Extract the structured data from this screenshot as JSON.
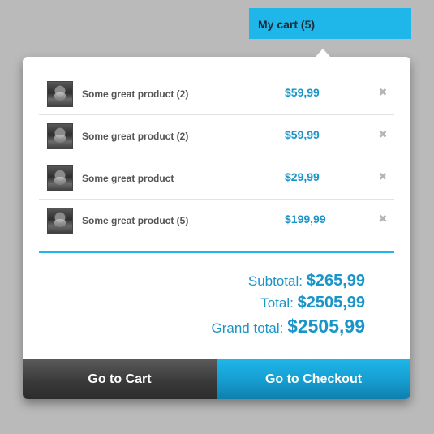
{
  "cart_tab": {
    "label": "My cart (5)"
  },
  "items": [
    {
      "name": "Some great product (2)",
      "price": "$59,99",
      "remove_icon": "close-icon"
    },
    {
      "name": "Some great product (2)",
      "price": "$59,99",
      "remove_icon": "close-icon"
    },
    {
      "name": "Some great product",
      "price": "$29,99",
      "remove_icon": "close-icon"
    },
    {
      "name": "Some great product (5)",
      "price": "$199,99",
      "remove_icon": "close-icon"
    }
  ],
  "totals": {
    "subtotal_label": "Subtotal: ",
    "subtotal_value": "$265,99",
    "total_label": "Total: ",
    "total_value": "$2505,99",
    "grand_total_label": "Grand total: ",
    "grand_total_value": "$2505,99"
  },
  "buttons": {
    "cart_label": "Go to Cart",
    "checkout_label": "Go to Checkout"
  },
  "colors": {
    "accent": "#1fb6ea",
    "price": "#1a95c8",
    "background": "#bababa"
  }
}
